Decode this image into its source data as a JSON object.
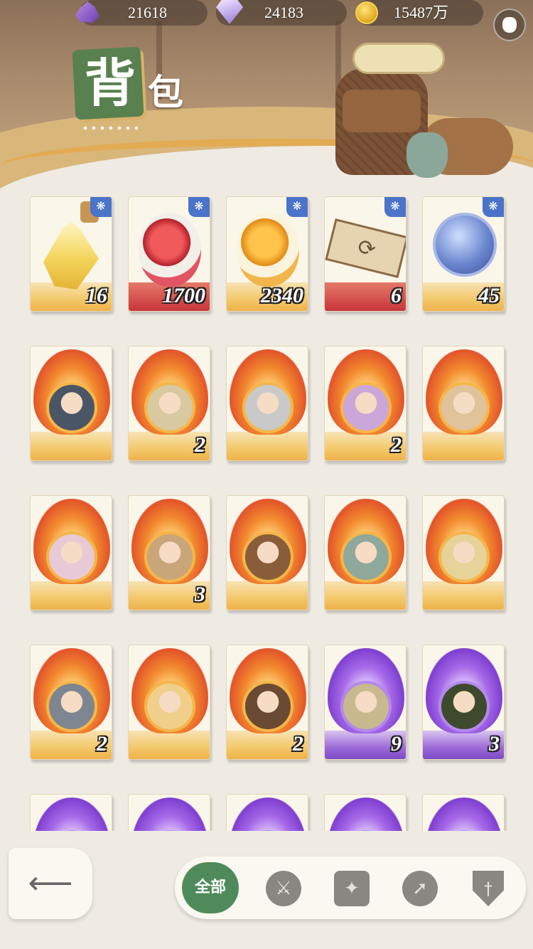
{
  "currencies": [
    {
      "icon": "amethyst-icon",
      "value": "21618"
    },
    {
      "icon": "diamond-icon",
      "value": "24183"
    },
    {
      "icon": "gold-coin-icon",
      "value": "15487万"
    }
  ],
  "title": {
    "char1": "背",
    "char2": "包"
  },
  "items": [
    {
      "name": "item-potion",
      "art": "potion-bottle",
      "theme": "gold",
      "count": "16",
      "star": true
    },
    {
      "name": "item-red-egg",
      "art": "red-egg",
      "theme": "red",
      "count": "1700",
      "star": true
    },
    {
      "name": "item-gold-egg",
      "art": "gold-egg",
      "theme": "gold",
      "count": "2340",
      "star": true
    },
    {
      "name": "item-ticket",
      "art": "ticket",
      "theme": "red",
      "count": "6",
      "star": true
    },
    {
      "name": "item-orb",
      "art": "blue-orb",
      "theme": "gold",
      "count": "45",
      "star": true
    },
    {
      "name": "hero-1",
      "art": "hero-portrait",
      "theme": "gold",
      "count": "",
      "star": false,
      "color": "#4a5566"
    },
    {
      "name": "hero-2",
      "art": "hero-portrait",
      "theme": "gold",
      "count": "2",
      "star": false,
      "color": "#d8c9a0"
    },
    {
      "name": "hero-3",
      "art": "hero-portrait",
      "theme": "gold",
      "count": "",
      "star": false,
      "color": "#c9c9c9"
    },
    {
      "name": "hero-4",
      "art": "hero-portrait",
      "theme": "gold",
      "count": "2",
      "star": false,
      "color": "#cba6d9"
    },
    {
      "name": "hero-5",
      "art": "hero-portrait",
      "theme": "gold",
      "count": "",
      "star": false,
      "color": "#e0c39a"
    },
    {
      "name": "hero-6",
      "art": "hero-portrait",
      "theme": "gold",
      "count": "",
      "star": false,
      "color": "#e8c9d6"
    },
    {
      "name": "hero-7",
      "art": "hero-portrait",
      "theme": "gold",
      "count": "3",
      "star": false,
      "color": "#c9a57a"
    },
    {
      "name": "hero-8",
      "art": "hero-portrait",
      "theme": "gold",
      "count": "",
      "star": false,
      "color": "#8a5d3a"
    },
    {
      "name": "hero-9",
      "art": "hero-portrait",
      "theme": "gold",
      "count": "",
      "star": false,
      "color": "#8fa89c"
    },
    {
      "name": "hero-10",
      "art": "hero-portrait",
      "theme": "gold",
      "count": "",
      "star": false,
      "color": "#e6d39a"
    },
    {
      "name": "hero-11",
      "art": "hero-portrait",
      "theme": "gold",
      "count": "2",
      "star": false,
      "color": "#7d8591"
    },
    {
      "name": "hero-12",
      "art": "hero-portrait",
      "theme": "gold",
      "count": "",
      "star": false,
      "color": "#f0cf8a"
    },
    {
      "name": "hero-13",
      "art": "hero-portrait",
      "theme": "gold",
      "count": "2",
      "star": false,
      "color": "#6b4a33"
    },
    {
      "name": "hero-14",
      "art": "hero-portrait",
      "theme": "purple",
      "count": "9",
      "star": false,
      "color": "#c8b98f"
    },
    {
      "name": "hero-15",
      "art": "hero-portrait",
      "theme": "purple",
      "count": "3",
      "star": false,
      "color": "#3e4a2e"
    },
    {
      "name": "hero-16",
      "art": "hero-portrait",
      "theme": "purple",
      "count": "",
      "star": false,
      "color": "#b89ad8"
    },
    {
      "name": "hero-17",
      "art": "hero-portrait",
      "theme": "purple",
      "count": "",
      "star": false,
      "color": "#b89ad8"
    },
    {
      "name": "hero-18",
      "art": "hero-portrait",
      "theme": "purple",
      "count": "",
      "star": false,
      "color": "#b89ad8"
    },
    {
      "name": "hero-19",
      "art": "hero-portrait",
      "theme": "purple",
      "count": "",
      "star": false,
      "color": "#b89ad8"
    },
    {
      "name": "hero-20",
      "art": "hero-portrait",
      "theme": "purple",
      "count": "",
      "star": false,
      "color": "#b89ad8"
    }
  ],
  "filters": {
    "all_label": "全部",
    "icons": [
      "warrior-helmet-icon",
      "star-compass-icon",
      "compass-icon",
      "sword-shield-icon"
    ]
  },
  "colors": {
    "accent_green": "#4f8b5a",
    "star_badge": "#4a73c9"
  }
}
